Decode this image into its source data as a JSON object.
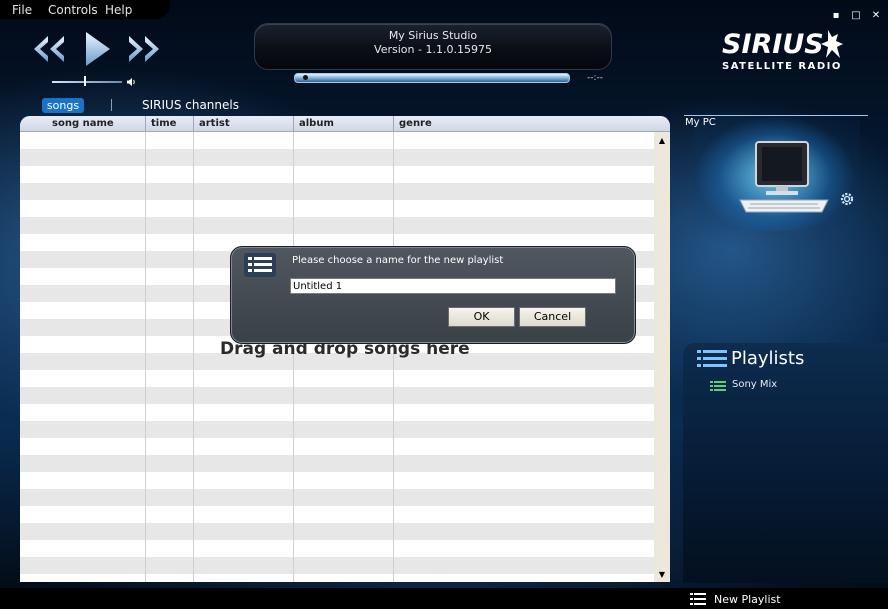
{
  "menu": {
    "file": "File",
    "controls": "Controls",
    "help": "Help"
  },
  "window_controls": {
    "minimize": "▪",
    "maximize": "□",
    "close": "✕"
  },
  "display": {
    "title": "My Sirius Studio",
    "version": "Version - 1.1.0.15975",
    "time": "--:--"
  },
  "logo": {
    "main": "SIRIUS",
    "sub": "SATELLITE RADIO"
  },
  "tabs": {
    "songs": "songs",
    "channels": "SIRIUS channels"
  },
  "table": {
    "columns": [
      "song name",
      "time",
      "artist",
      "album",
      "genre"
    ],
    "drop_hint": "Drag and drop songs here"
  },
  "my_pc": {
    "label": "My PC"
  },
  "playlists": {
    "title": "Playlists",
    "items": [
      {
        "label": "Sony Mix"
      }
    ]
  },
  "bottom": {
    "new_playlist": "New Playlist"
  },
  "dialog": {
    "prompt": "Please choose a name for the new playlist",
    "input_value": "Untitled 1",
    "ok": "OK",
    "cancel": "Cancel"
  },
  "colors": {
    "accent": "#1b73c9",
    "dialog_bg": "#454b52",
    "row_alt": "#e7e7e7"
  },
  "icons": {
    "prev": "rewind-icon",
    "play": "play-icon",
    "next": "fast-forward-icon",
    "logo": "sirius-dog-icon"
  }
}
